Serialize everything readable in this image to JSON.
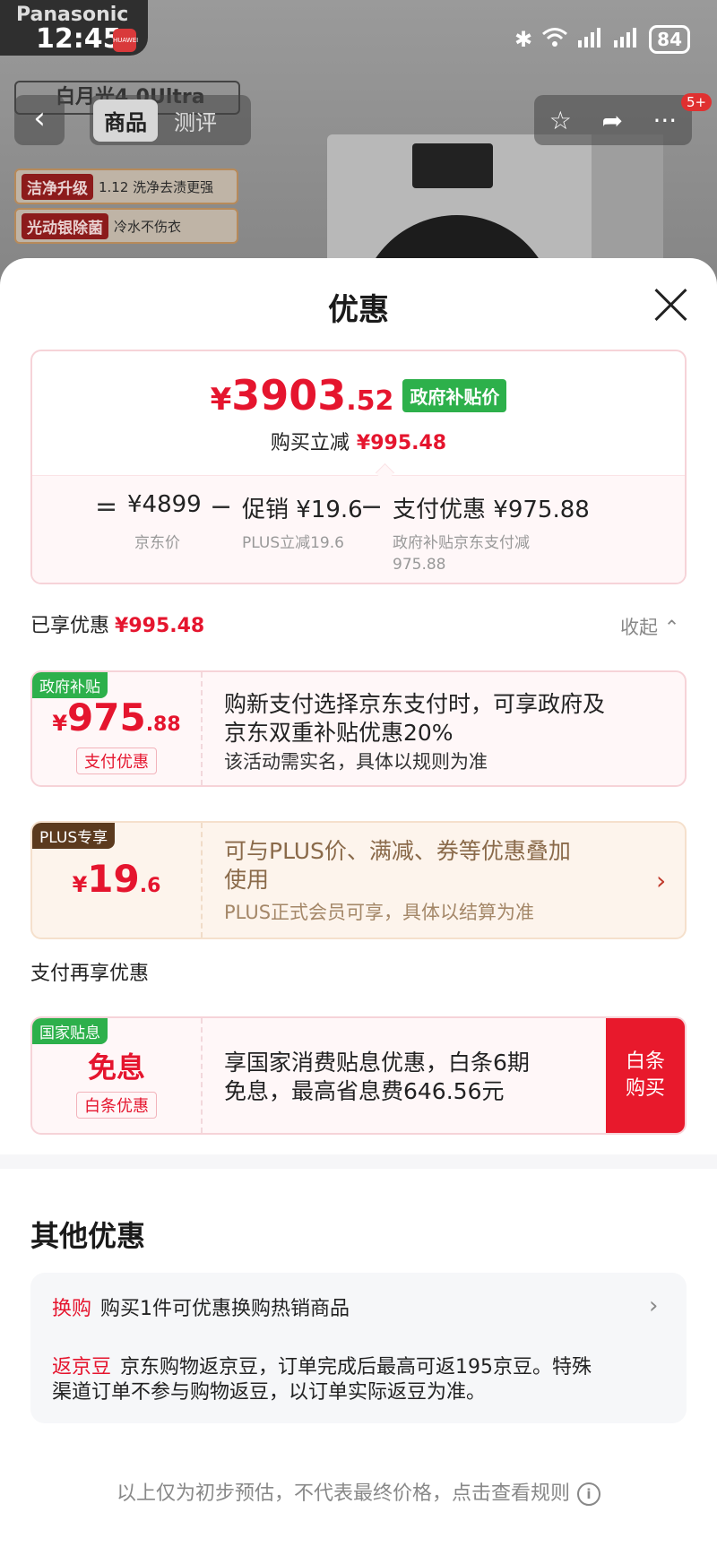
{
  "status_bar": {
    "time": "12:45",
    "battery": "84"
  },
  "background": {
    "brand": "Panasonic",
    "model": "白月光4.0Ultra",
    "tabs": [
      "商品",
      "测评"
    ],
    "notification_count": "5+",
    "tags": [
      {
        "label": "洁净升级",
        "text": "1.12 洗净去渍更强"
      },
      {
        "label": "光动银除菌",
        "text": "冷水不伤衣"
      }
    ]
  },
  "sheet": {
    "title": "优惠",
    "summary": {
      "price_symbol": "¥",
      "price_int": "3903",
      "price_dec": ".52",
      "price_tag": "政府补贴价",
      "save_label": "购买立减",
      "save_value": "¥995.48",
      "eq": "=",
      "minus": "−",
      "jd_price": "¥4899",
      "jd_price_label": "京东价",
      "promo_label": "促销",
      "promo_value": "¥19.6",
      "promo_sub": "PLUS立减19.6",
      "pay_label": "支付优惠",
      "pay_value": "¥975.88",
      "pay_sub_line1": "政府补贴京东支付减",
      "pay_sub_line2": "975.88"
    },
    "enjoyed_label": "已享优惠",
    "enjoyed_value": "¥995.48",
    "collapse_label": "收起",
    "cards": [
      {
        "tag": "政府补贴",
        "symbol": "¥",
        "int": "975",
        "dec": ".88",
        "badge": "支付优惠",
        "line1": "购新支付选择京东支付时，可享政府及",
        "line2": "京东双重补贴优惠20%",
        "sub": "该活动需实名，具体以规则为准"
      },
      {
        "tag": "PLUS专享",
        "symbol": "¥",
        "int": "19",
        "dec": ".6",
        "line1": "可与PLUS价、满减、券等优惠叠加",
        "line2": "使用",
        "sub": "PLUS正式会员可享，具体以结算为准"
      }
    ],
    "pay_section_title": "支付再享优惠",
    "pay_card": {
      "tag": "国家贴息",
      "title": "免息",
      "badge": "白条优惠",
      "line1": "享国家消费贴息优惠，白条6期",
      "line2": "免息，最高省息费646.56元",
      "button_line1": "白条",
      "button_line2": "购买"
    },
    "other_title": "其他优惠",
    "other_items": [
      {
        "label": "换购",
        "text": "购买1件可优惠换购热销商品"
      },
      {
        "label": "返京豆",
        "text": "京东购物返京豆，订单完成后最高可返195京豆。特殊渠道订单不参与购物返豆，以订单实际返豆为准。"
      }
    ],
    "footer_note": "以上仅为初步预估，不代表最终价格，点击查看规则"
  },
  "colors": {
    "accent_red": "#e5152e",
    "gov_green": "#2db04b",
    "plus_brown": "#5b3a1e",
    "button_red": "#e8192c"
  }
}
